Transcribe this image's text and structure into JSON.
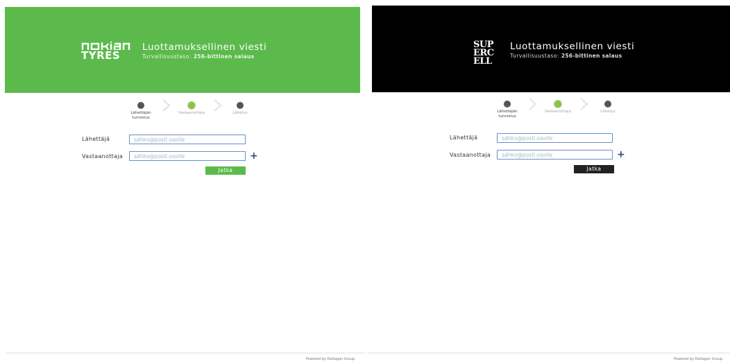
{
  "brands": [
    {
      "id": "nokian",
      "header_color": "#5cba4c",
      "logo_text_top": "nokian",
      "logo_text_bottom": "TYRES",
      "logo_registered": "®",
      "title": "Luottamuksellinen viesti",
      "subtitle_prefix": "Turvallisuustaso:",
      "subtitle_value": "256-bittinen salaus",
      "steps": [
        {
          "label": "Lähettäjän tunnistus",
          "state": "done"
        },
        {
          "label": "Vastaanottaja",
          "state": "active"
        },
        {
          "label": "Lähetys",
          "state": "pending"
        }
      ],
      "sender_label": "Lähettäjä",
      "sender_placeholder": "sähko@posti.osoite",
      "recipient_label": "Vastaanottaja",
      "recipient_placeholder": "sähko@posti.osoite",
      "add_recipient_icon": "plus-icon",
      "add_recipient_symbol": "+",
      "continue_label": "Jatka",
      "button_color": "#5cba4c",
      "footer_text": "Powered by Deltagon Group"
    },
    {
      "id": "supercell",
      "header_color": "#000000",
      "logo_text": [
        "SUP",
        "ERC",
        "ELL"
      ],
      "title": "Luottamuksellinen viesti",
      "subtitle_prefix": "Turvallisuustaso:",
      "subtitle_value": "256-bittinen salaus",
      "steps": [
        {
          "label": "Lähettäjän tunnistus",
          "state": "done"
        },
        {
          "label": "Vastaanottaja",
          "state": "active"
        },
        {
          "label": "Lähetys",
          "state": "pending"
        }
      ],
      "sender_label": "Lähettäjä",
      "sender_placeholder": "sähko@posti.osoite",
      "recipient_label": "Vastaanottaja",
      "recipient_placeholder": "sähko@posti.osoite",
      "add_recipient_icon": "plus-icon",
      "add_recipient_symbol": "+",
      "continue_label": "Jatka",
      "button_color": "#222222",
      "footer_text": "Powered by Deltagon Group"
    }
  ]
}
